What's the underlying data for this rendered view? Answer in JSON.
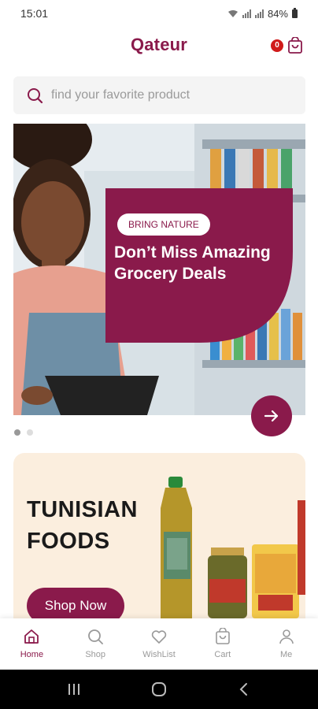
{
  "status": {
    "time": "15:01",
    "battery": "84%"
  },
  "header": {
    "logo": "Qateur",
    "cart_count": "0"
  },
  "search": {
    "placeholder": "find your favorite product"
  },
  "hero": {
    "chip": "BRING NATURE",
    "title": "Don’t Miss Amazing Grocery Deals",
    "slide_count": 2,
    "active_slide": 1
  },
  "promo": {
    "title_line1": "TUNISIAN",
    "title_line2": "FOODS",
    "button": "Shop Now"
  },
  "bottom_nav": {
    "items": [
      {
        "label": "Home",
        "icon": "home-icon",
        "active": true
      },
      {
        "label": "Shop",
        "icon": "search-icon",
        "active": false
      },
      {
        "label": "WishList",
        "icon": "heart-icon",
        "active": false
      },
      {
        "label": "Cart",
        "icon": "cart-icon",
        "active": false
      },
      {
        "label": "Me",
        "icon": "user-icon",
        "active": false
      }
    ]
  },
  "colors": {
    "brand": "#8a1a4b",
    "badge": "#d01a1a",
    "promo_bg": "#fbeede"
  }
}
